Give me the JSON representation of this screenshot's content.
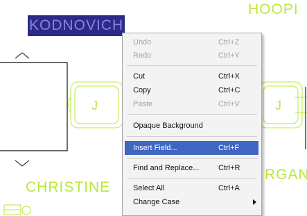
{
  "drawing": {
    "selected_text": "KODNOVICH",
    "label_top_right": "HOOPI",
    "label_bottom_left": "CHRISTINE",
    "label_bottom_right": "RGAN",
    "symbol_left_letter": "J",
    "symbol_right_letter": "J",
    "colors": {
      "cad_line": "#b8e83a",
      "black_line": "#111111",
      "selection_bg": "#2b2b86",
      "selection_text": "#8c7ef0",
      "menu_highlight": "#3f67c2"
    }
  },
  "context_menu": {
    "items": [
      {
        "label": "Undo",
        "shortcut": "Ctrl+Z",
        "enabled": false
      },
      {
        "label": "Redo",
        "shortcut": "Ctrl+Y",
        "enabled": false
      },
      {
        "label": "Cut",
        "shortcut": "Ctrl+X",
        "enabled": true
      },
      {
        "label": "Copy",
        "shortcut": "Ctrl+C",
        "enabled": true
      },
      {
        "label": "Paste",
        "shortcut": "Ctrl+V",
        "enabled": false
      },
      {
        "label": "Opaque Background",
        "shortcut": "",
        "enabled": true
      },
      {
        "label": "Insert Field...",
        "shortcut": "Ctrl+F",
        "enabled": true,
        "highlighted": true
      },
      {
        "label": "Find and Replace...",
        "shortcut": "Ctrl+R",
        "enabled": true
      },
      {
        "label": "Select All",
        "shortcut": "Ctrl+A",
        "enabled": true
      },
      {
        "label": "Change Case",
        "shortcut": "",
        "enabled": true,
        "submenu": true
      }
    ]
  }
}
